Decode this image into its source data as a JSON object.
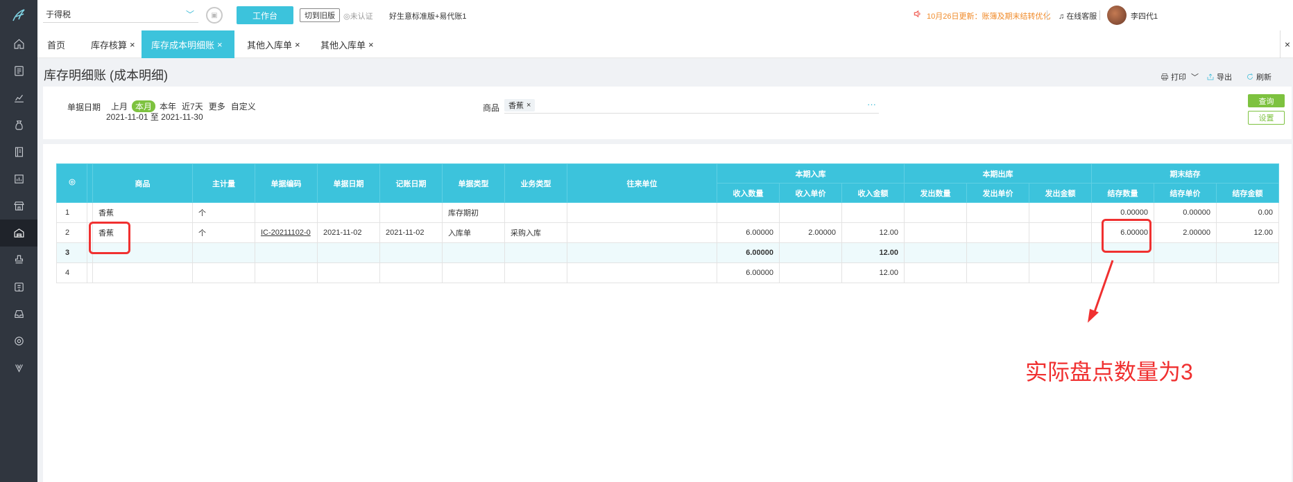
{
  "topbar": {
    "company": "于得税",
    "workbench": "工作台",
    "switch_old": "切到旧版",
    "cert": "◎未认证",
    "edition": "好生意标准版+易代账1",
    "notice": "10月26日更新：账簿及期末结转优化",
    "service": "在线客服",
    "user": "李四代1"
  },
  "tabs": [
    "首页",
    "库存核算",
    "库存成本明细账",
    "其他入库单",
    "其他入库单"
  ],
  "page": {
    "title": "库存明细账 (成本明细)",
    "print": "打印",
    "export": "导出",
    "refresh": "刷新"
  },
  "filter": {
    "date_label": "单据日期",
    "quick": [
      "上月",
      "本月",
      "本年",
      "近7天",
      "更多",
      "自定义"
    ],
    "date_range": "2021-11-01 至 2021-11-30",
    "goods_label": "商品",
    "goods_chip": "香蕉",
    "query": "查询",
    "setting": "设置"
  },
  "table": {
    "headers": {
      "goods": "商品",
      "unit": "主计量",
      "doc_no": "单据编码",
      "doc_date": "单据日期",
      "post_date": "记账日期",
      "doc_type": "单据类型",
      "biz_type": "业务类型",
      "partner": "往来单位",
      "in_group": "本期入库",
      "out_group": "本期出库",
      "end_group": "期末结存",
      "in_qty": "收入数量",
      "in_price": "收入单价",
      "in_amt": "收入金额",
      "out_qty": "发出数量",
      "out_price": "发出单价",
      "out_amt": "发出金额",
      "end_qty": "结存数量",
      "end_price": "结存单价",
      "end_amt": "结存金额"
    },
    "rows": [
      {
        "idx": "1",
        "goods": "香蕉",
        "unit": "个",
        "doc_no": "",
        "doc_date": "",
        "post_date": "",
        "doc_type": "库存期初",
        "biz_type": "",
        "partner": "",
        "in_qty": "",
        "in_price": "",
        "in_amt": "",
        "out_qty": "",
        "out_price": "",
        "out_amt": "",
        "end_qty": "0.00000",
        "end_price": "0.00000",
        "end_amt": "0.00"
      },
      {
        "idx": "2",
        "goods": "香蕉",
        "unit": "个",
        "doc_no": "IC-20211102-0",
        "doc_date": "2021-11-02",
        "post_date": "2021-11-02",
        "doc_type": "入库单",
        "biz_type": "采购入库",
        "partner": "",
        "in_qty": "6.00000",
        "in_price": "2.00000",
        "in_amt": "12.00",
        "out_qty": "",
        "out_price": "",
        "out_amt": "",
        "end_qty": "6.00000",
        "end_price": "2.00000",
        "end_amt": "12.00"
      },
      {
        "idx": "3",
        "goods": "",
        "unit": "",
        "doc_no": "",
        "doc_date": "",
        "post_date": "",
        "doc_type": "",
        "biz_type": "",
        "partner": "",
        "in_qty": "6.00000",
        "in_price": "",
        "in_amt": "12.00",
        "out_qty": "",
        "out_price": "",
        "out_amt": "",
        "end_qty": "",
        "end_price": "",
        "end_amt": ""
      },
      {
        "idx": "4",
        "goods": "",
        "unit": "",
        "doc_no": "",
        "doc_date": "",
        "post_date": "",
        "doc_type": "",
        "biz_type": "",
        "partner": "",
        "in_qty": "6.00000",
        "in_price": "",
        "in_amt": "12.00",
        "out_qty": "",
        "out_price": "",
        "out_amt": "",
        "end_qty": "",
        "end_price": "",
        "end_amt": ""
      }
    ]
  },
  "annotation": "实际盘点数量为3",
  "colors": {
    "accent": "#3cc3dc",
    "green": "#7dc23f",
    "rail": "#30363f",
    "annotation": "#f03030",
    "notice": "#f08a28"
  },
  "icons": [
    "logo-icon",
    "home-icon",
    "voucher-icon",
    "chart-icon",
    "money-bag-icon",
    "book-icon",
    "report-icon",
    "store-icon",
    "inventory-icon",
    "stamp-icon",
    "invoice-icon",
    "tray-icon",
    "gear-icon",
    "v-icon",
    "speaker-icon",
    "headset-icon",
    "printer-icon",
    "export-icon",
    "refresh-icon",
    "settings-column-icon"
  ]
}
